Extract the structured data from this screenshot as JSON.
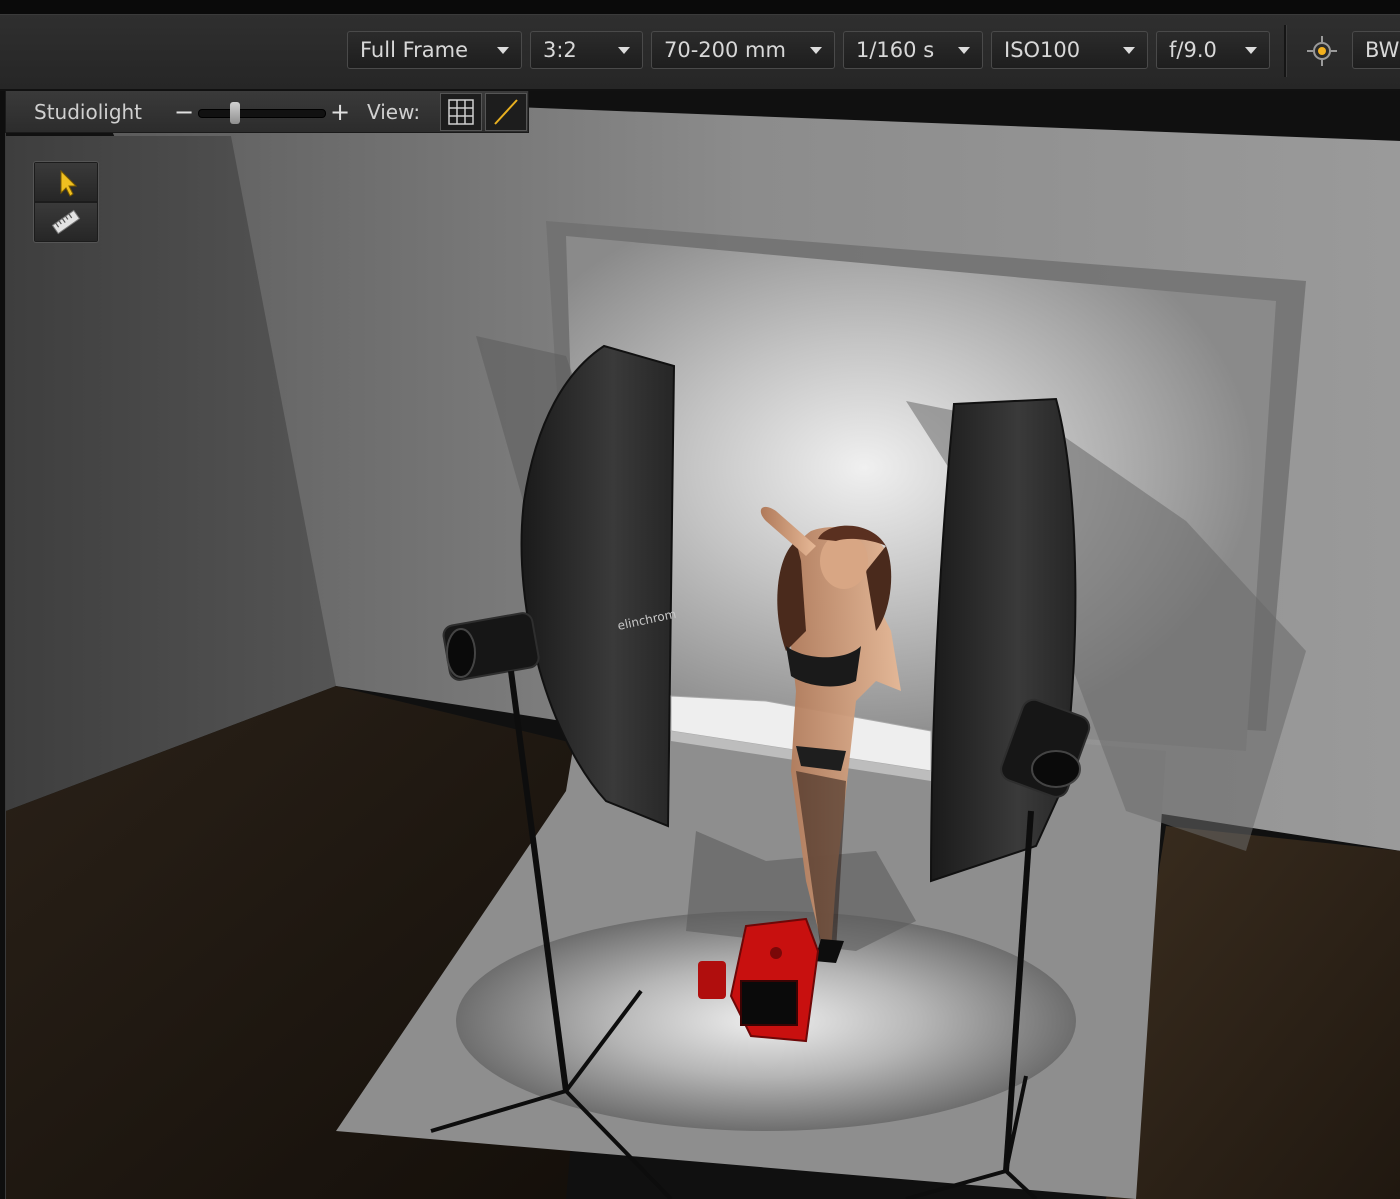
{
  "toolbar": {
    "sensor": "Full Frame",
    "aspect": "3:2",
    "lens": "70-200 mm",
    "shutter": "1/160 s",
    "iso": "ISO100",
    "aperture": "f/9.0",
    "bw": "BW"
  },
  "subbar": {
    "title": "Studiolight",
    "minus": "−",
    "plus": "+",
    "view_label": "View:",
    "zoom_level": 0.27
  },
  "scene": {
    "softbox_brand": "elinchrom",
    "accent_colors": {
      "camera": "#c8100f",
      "tool_active": "#f0c020"
    }
  },
  "icons": [
    "chevron-down-icon",
    "light-target-icon",
    "grid-view-icon",
    "diagonal-view-icon",
    "select-arrow-icon",
    "ruler-icon"
  ]
}
